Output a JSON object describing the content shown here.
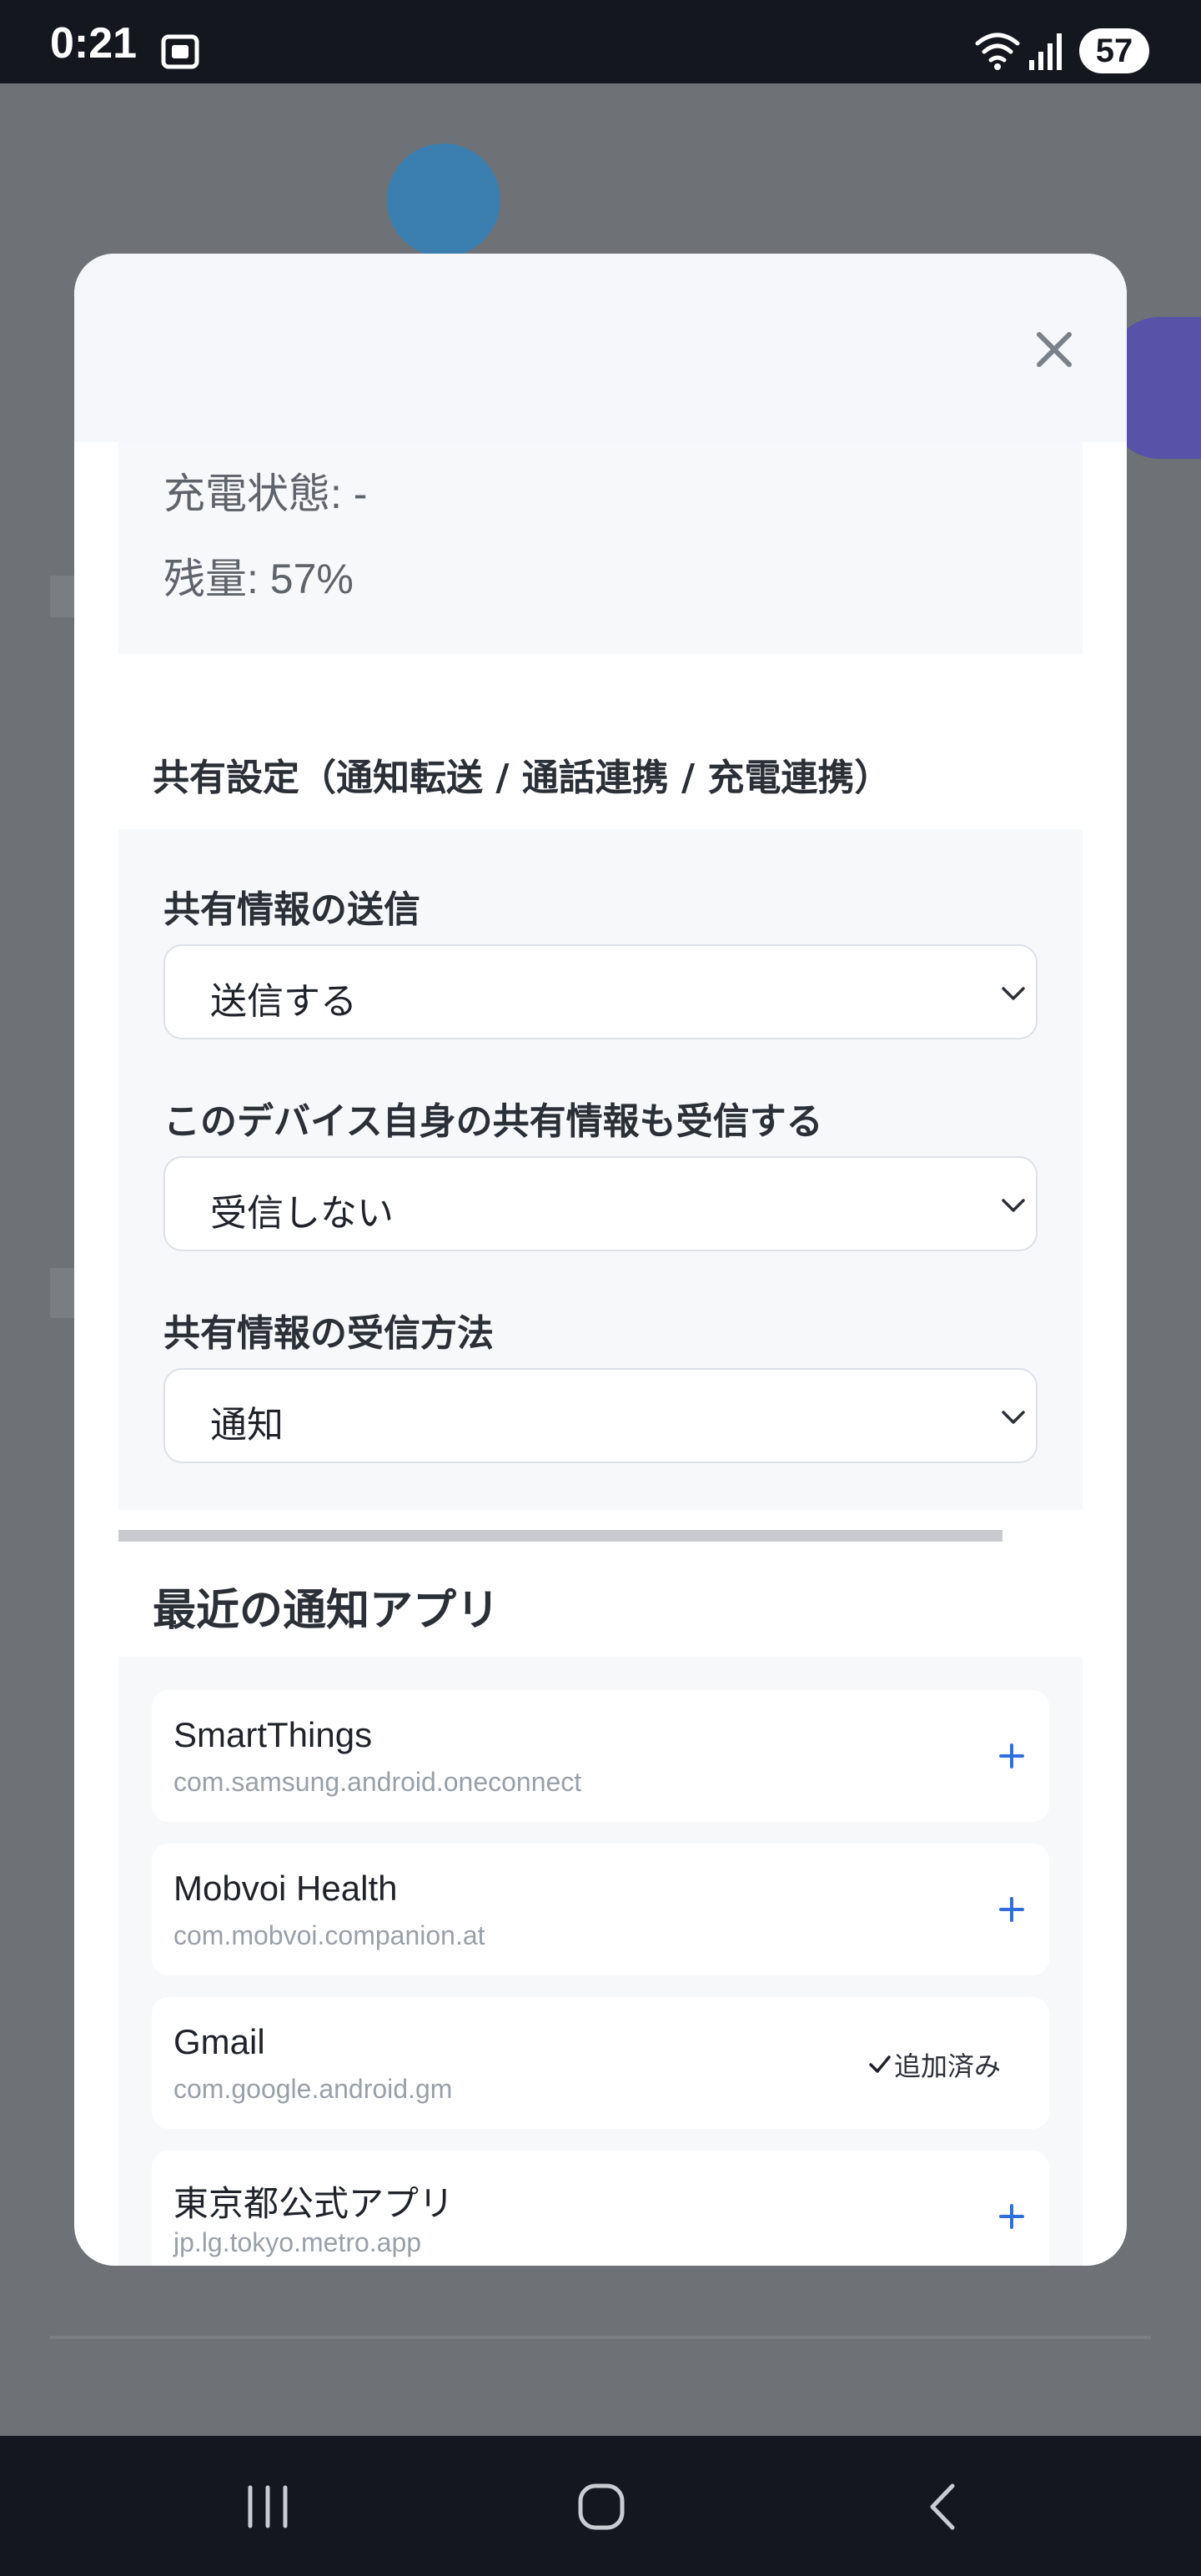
{
  "status_bar": {
    "time": "0:21",
    "battery_level": "57"
  },
  "device_info": {
    "charging_status": "充電状態: -",
    "battery_remaining": "残量: 57%"
  },
  "share_settings": {
    "title": "共有設定（通知転送 / 通話連携 / 充電連携）",
    "send_label": "共有情報の送信",
    "send_value": "送信する",
    "receive_self_label": "このデバイス自身の共有情報も受信する",
    "receive_self_value": "受信しない",
    "receive_method_label": "共有情報の受信方法",
    "receive_method_value": "通知"
  },
  "recent_apps": {
    "title": "最近の通知アプリ",
    "apps": [
      {
        "name": "SmartThings",
        "package": "com.samsung.android.oneconnect",
        "action": "add"
      },
      {
        "name": "Mobvoi Health",
        "package": "com.mobvoi.companion.at",
        "action": "add"
      },
      {
        "name": "Gmail",
        "package": "com.google.android.gm",
        "action": "added",
        "status": "追加済み"
      },
      {
        "name": "東京都公式アプリ",
        "package": "jp.lg.tokyo.metro.app",
        "action": "add"
      }
    ]
  },
  "colors": {
    "accent_blue": "#2f6fe0",
    "status_bar_bg": "#14171d",
    "panel_bg": "#f7f8fa"
  },
  "icons": [
    "screenshot-icon",
    "wifi-icon",
    "signal-icon",
    "close-icon",
    "chevron-down-icon",
    "add-icon",
    "check-icon",
    "recents-icon",
    "home-icon",
    "back-icon"
  ]
}
